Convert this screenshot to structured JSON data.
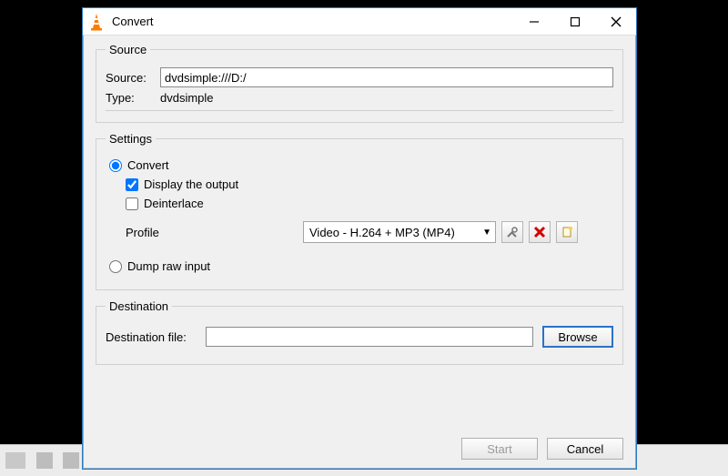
{
  "window": {
    "title": "Convert"
  },
  "source_group": {
    "legend": "Source",
    "source_label": "Source:",
    "source_value": "dvdsimple:///D:/",
    "type_label": "Type:",
    "type_value": "dvdsimple"
  },
  "settings_group": {
    "legend": "Settings",
    "convert_radio": "Convert",
    "display_output_check": "Display the output",
    "display_output_checked": true,
    "deinterlace_check": "Deinterlace",
    "deinterlace_checked": false,
    "profile_label": "Profile",
    "profile_value": "Video - H.264 + MP3 (MP4)",
    "dump_raw_radio": "Dump raw input",
    "selected_radio": "convert"
  },
  "destination_group": {
    "legend": "Destination",
    "dest_label": "Destination file:",
    "dest_value": "",
    "browse_btn": "Browse"
  },
  "buttons": {
    "start": "Start",
    "cancel": "Cancel"
  },
  "icons": {
    "edit_profile": "wrench-screwdriver",
    "delete_profile": "red-x",
    "new_profile": "new-file"
  }
}
